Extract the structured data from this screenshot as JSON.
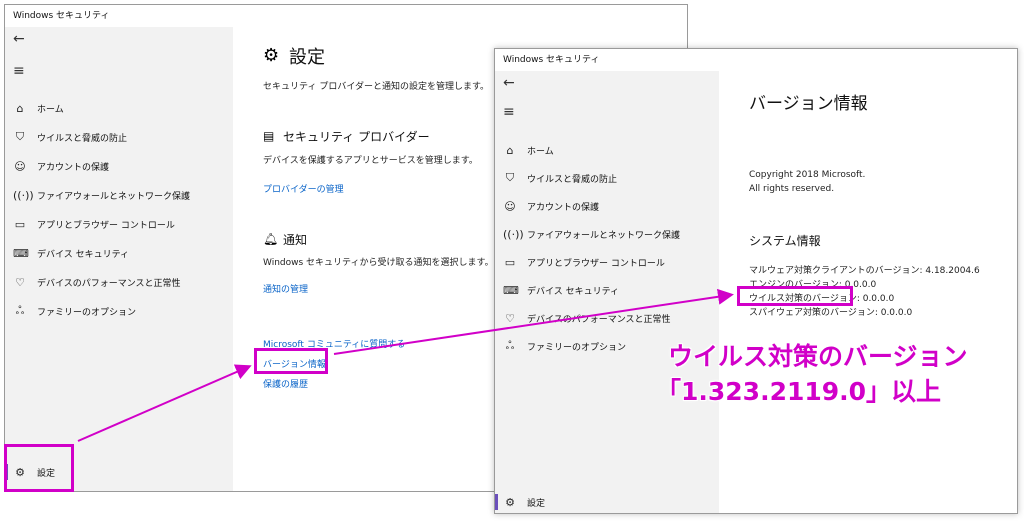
{
  "win1": {
    "title": "Windows セキュリティ",
    "nav": [
      {
        "label": "ホーム",
        "icon": "home-icon"
      },
      {
        "label": "ウイルスと脅威の防止",
        "icon": "shield-icon"
      },
      {
        "label": "アカウントの保護",
        "icon": "person-icon"
      },
      {
        "label": "ファイアウォールとネットワーク保護",
        "icon": "antenna-icon"
      },
      {
        "label": "アプリとブラウザー コントロール",
        "icon": "browser-window-icon"
      },
      {
        "label": "デバイス セキュリティ",
        "icon": "laptop-icon"
      },
      {
        "label": "デバイスのパフォーマンスと正常性",
        "icon": "heart-icon"
      },
      {
        "label": "ファミリーのオプション",
        "icon": "family-icon"
      }
    ],
    "settings_label": "設定",
    "page_title": "設定",
    "page_subtitle": "セキュリティ プロバイダーと通知の設定を管理します。",
    "provider_heading": "セキュリティ プロバイダー",
    "provider_desc": "デバイスを保護するアプリとサービスを管理します。",
    "provider_link": "プロバイダーの管理",
    "notify_heading": "通知",
    "notify_desc": "Windows セキュリティから受け取る通知を選択します。",
    "notify_link": "通知の管理",
    "community_link": "Microsoft コミュニティに質問する",
    "version_link": "バージョン情報",
    "history_link": "保護の履歴"
  },
  "win2": {
    "title": "Windows セキュリティ",
    "nav": [
      {
        "label": "ホーム",
        "icon": "home-icon"
      },
      {
        "label": "ウイルスと脅威の防止",
        "icon": "shield-icon"
      },
      {
        "label": "アカウントの保護",
        "icon": "person-icon"
      },
      {
        "label": "ファイアウォールとネットワーク保護",
        "icon": "antenna-icon"
      },
      {
        "label": "アプリとブラウザー コントロール",
        "icon": "browser-window-icon"
      },
      {
        "label": "デバイス セキュリティ",
        "icon": "laptop-icon"
      },
      {
        "label": "デバイスのパフォーマンスと正常性",
        "icon": "heart-icon"
      },
      {
        "label": "ファミリーのオプション",
        "icon": "family-icon"
      }
    ],
    "settings_label": "設定",
    "page_title": "バージョン情報",
    "copyright_1": "Copyright 2018 Microsoft.",
    "copyright_2": "All rights reserved.",
    "sysinfo_heading": "システム情報",
    "malware_client": "マルウェア対策クライアントのバージョン: 4.18.2004.6",
    "engine": "エンジンのバージョン: 0.0.0.0",
    "antivirus": "ウイルス対策のバージョン: 0.0.0.0",
    "antispyware": "スパイウェア対策のバージョン: 0.0.0.0"
  },
  "annotation": {
    "line1": "ウイルス対策のバージョン",
    "line2": "「1.323.2119.0」以上",
    "color": "#d100c8"
  }
}
